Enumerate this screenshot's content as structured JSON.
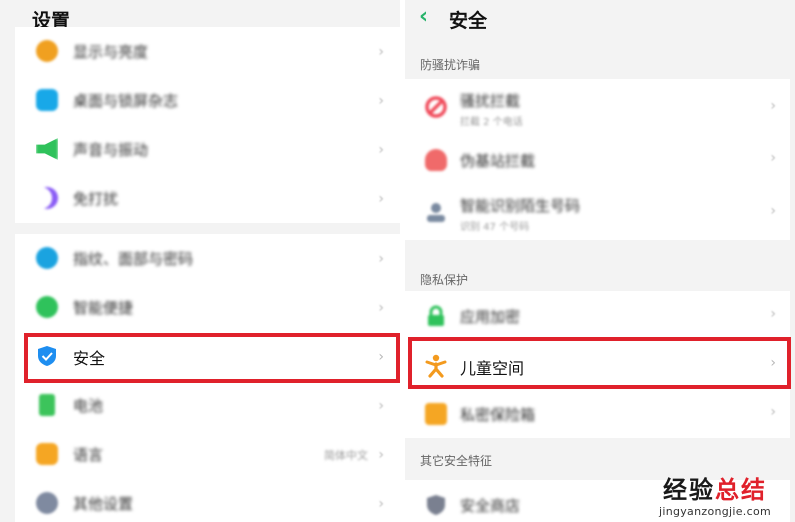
{
  "left": {
    "title": "设置",
    "group1": [
      {
        "label": "显示与亮度",
        "icon": "display-brightness-icon",
        "color": "#f0a020"
      },
      {
        "label": "桌面与锁屏杂志",
        "icon": "wallpaper-icon",
        "color": "#18a8e8"
      },
      {
        "label": "声音与振动",
        "icon": "sound-icon",
        "color": "#2fc25b"
      },
      {
        "label": "免打扰",
        "icon": "moon-icon",
        "color": "#8a5cf5"
      }
    ],
    "group2": [
      {
        "label": "指纹、面部与密码",
        "icon": "fingerprint-icon",
        "color": "#1aa3e0",
        "sub": ""
      },
      {
        "label": "智能便捷",
        "icon": "smart-assist-icon",
        "color": "#2fc25b",
        "sub": ""
      },
      {
        "label": "安全",
        "icon": "shield-icon",
        "color": "#1e8ef0",
        "sub": ""
      },
      {
        "label": "电池",
        "icon": "battery-icon",
        "color": "#3cc45b",
        "sub": ""
      },
      {
        "label": "语言",
        "icon": "language-icon",
        "color": "#f5a623",
        "sub": "简体中文"
      },
      {
        "label": "其他设置",
        "icon": "gear-icon",
        "color": "#7f8aa0",
        "sub": ""
      }
    ]
  },
  "right": {
    "back_icon": "chevron-left-icon",
    "title": "安全",
    "sections": [
      {
        "header": "防骚扰诈骗",
        "rows": [
          {
            "label": "骚扰拦截",
            "sub": "拦截 2 个电话",
            "icon": "block-icon",
            "color": "#f04a5a"
          },
          {
            "label": "伪基站拦截",
            "sub": "",
            "icon": "fake-station-icon",
            "color": "#f06a6a"
          },
          {
            "label": "智能识别陌生号码",
            "sub": "识别 47 个号码",
            "icon": "caller-id-icon",
            "color": "#7a8aa0"
          }
        ]
      },
      {
        "header": "隐私保护",
        "rows": [
          {
            "label": "应用加密",
            "sub": "",
            "icon": "lock-icon",
            "color": "#2fc25b"
          },
          {
            "label": "儿童空间",
            "sub": "",
            "icon": "child-icon",
            "color": "#f39a1e"
          },
          {
            "label": "私密保险箱",
            "sub": "",
            "icon": "safe-box-icon",
            "color": "#f5a623"
          }
        ]
      },
      {
        "header": "其它安全特征",
        "rows": [
          {
            "label": "安全商店",
            "sub": "",
            "icon": "store-shield-icon",
            "color": "#7a8090"
          }
        ]
      }
    ]
  },
  "chevron": "›",
  "highlight_color": "#e0212b",
  "accent": "#28b36b",
  "watermark": {
    "cn_main": "经验",
    "cn_red": "总结",
    "en": "jingyanzongjie.com"
  }
}
